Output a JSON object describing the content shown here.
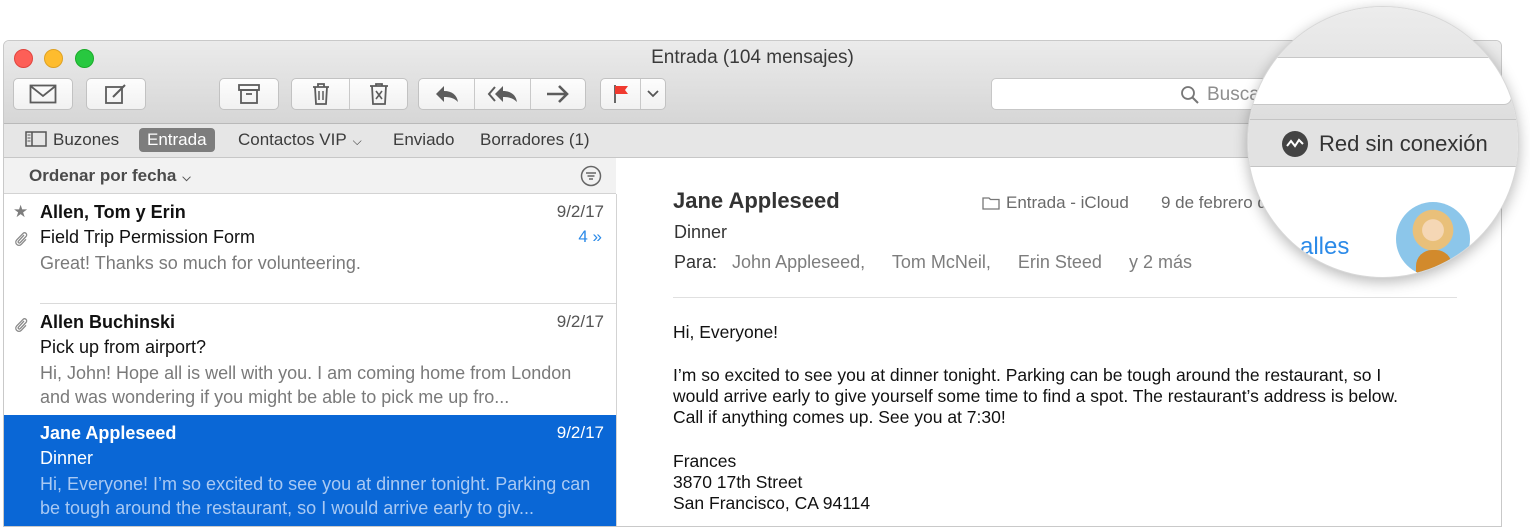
{
  "window": {
    "title": "Entrada (104 mensajes)"
  },
  "toolbar": {
    "buttons": [
      "envelope-icon",
      "compose-icon",
      "archive-icon",
      "trash-icon",
      "junk-icon",
      "reply-icon",
      "reply-all-icon",
      "forward-icon",
      "flag-icon",
      "chevron-down-icon"
    ],
    "flag_color": "#f03a2f",
    "search_placeholder": "Busca"
  },
  "favorites": {
    "mailboxes": "Buzones",
    "inbox": "Entrada",
    "vip": "Contactos VIP",
    "sent": "Enviado",
    "drafts": "Borradores (1)"
  },
  "sort": {
    "label": "Ordenar por fecha"
  },
  "messages": [
    {
      "sender": "Allen, Tom y Erin",
      "date": "9/2/17",
      "subject": "Field Trip Permission Form",
      "preview": "Great! Thanks so much for volunteering.",
      "thread_count": "4 »",
      "starred": true,
      "attachment": true
    },
    {
      "sender": "Allen Buchinski",
      "date": "9/2/17",
      "subject": "Pick up from airport?",
      "preview": "Hi, John! Hope all is well with you. I am coming home from London and was wondering if you might be able to pick me up fro...",
      "attachment": true
    },
    {
      "sender": "Jane Appleseed",
      "date": "9/2/17",
      "subject": "Dinner",
      "preview": "Hi, Everyone! I’m so excited to see you at dinner tonight. Parking can be tough around the restaurant, so I would arrive early to giv...",
      "selected": true
    }
  ],
  "reader": {
    "from": "Jane Appleseed",
    "mailbox": "Entrada - iCloud",
    "date": "9 de febrero d",
    "subject": "Dinner",
    "to_label": "Para:",
    "recipients": [
      "John Appleseed,",
      "Tom McNeil,",
      "Erin Steed",
      "y 2 más"
    ],
    "greeting": "Hi, Everyone!",
    "body_lines": [
      "I’m so excited to see you at dinner tonight. Parking can be tough around the restaurant, so I",
      "would arrive early to give yourself some time to find a spot. The restaurant’s address is below.",
      "Call if anything comes up. See you at 7:30!"
    ],
    "signature": [
      "Frances",
      "3870 17th Street",
      "San Francisco, CA 94114"
    ]
  },
  "magnifier": {
    "status": "Red sin conexión",
    "status_icon": "offline-activity-icon",
    "details_link": "alles"
  },
  "colors": {
    "selection": "#0a67d6",
    "link": "#2b8ae8"
  }
}
